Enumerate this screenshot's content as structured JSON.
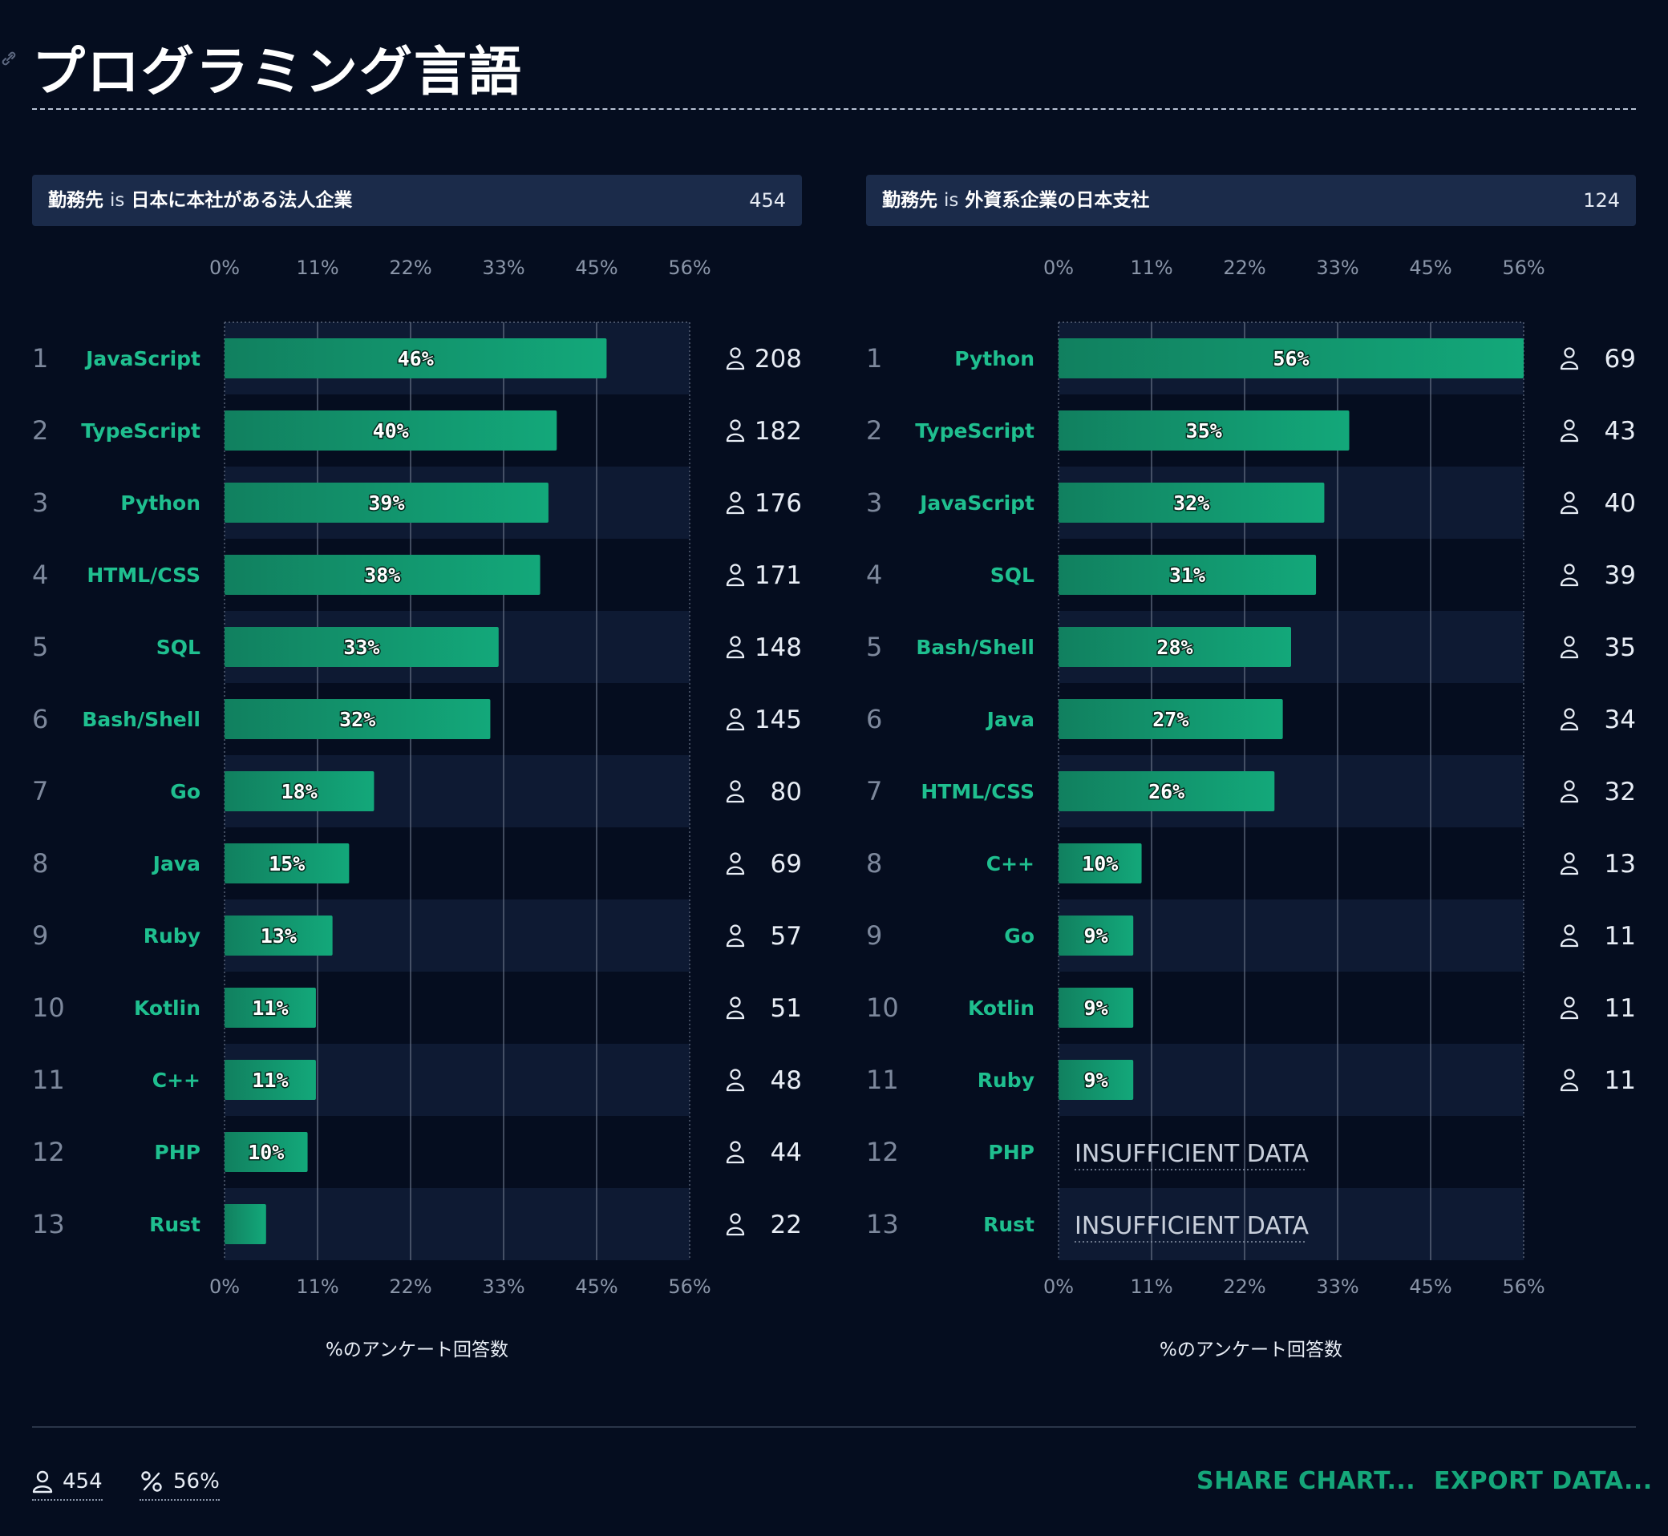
{
  "page": {
    "title": "プログラミング言語",
    "icons": [
      "link-icon",
      "person-icon",
      "percent-icon"
    ],
    "colors": {
      "background": "#050d1f",
      "bar": "#13a87a",
      "label": "#1fbf8f",
      "filter_bar": "#1b2b4a",
      "row_band": "#0e1a33"
    }
  },
  "panels": [
    {
      "filter_field": "勤務先",
      "filter_op": "is",
      "filter_value": "日本に本社がある法人企業",
      "total": "454",
      "axis_title": "%のアンケート回答数"
    },
    {
      "filter_field": "勤務先",
      "filter_op": "is",
      "filter_value": "外資系企業の日本支社",
      "total": "124",
      "axis_title": "%のアンケート回答数"
    }
  ],
  "chart_data": [
    {
      "type": "bar",
      "orientation": "horizontal",
      "xlim": [
        0,
        56
      ],
      "tick_labels": [
        "0%",
        "11%",
        "22%",
        "33%",
        "45%",
        "56%"
      ],
      "xlabel": "%のアンケート回答数",
      "grid": true,
      "categories": [
        "JavaScript",
        "TypeScript",
        "Python",
        "HTML/CSS",
        "SQL",
        "Bash/Shell",
        "Go",
        "Java",
        "Ruby",
        "Kotlin",
        "C++",
        "PHP",
        "Rust"
      ],
      "values": [
        46,
        40,
        39,
        38,
        33,
        32,
        18,
        15,
        13,
        11,
        11,
        10,
        5
      ],
      "value_labels": [
        "46%",
        "40%",
        "39%",
        "38%",
        "33%",
        "32%",
        "18%",
        "15%",
        "13%",
        "11%",
        "11%",
        "10%",
        ""
      ],
      "counts": [
        "208",
        "182",
        "176",
        "171",
        "148",
        "145",
        "80",
        "69",
        "57",
        "51",
        "48",
        "44",
        "22"
      ],
      "insufficient_label": ""
    },
    {
      "type": "bar",
      "orientation": "horizontal",
      "xlim": [
        0,
        56
      ],
      "tick_labels": [
        "0%",
        "11%",
        "22%",
        "33%",
        "45%",
        "56%"
      ],
      "xlabel": "%のアンケート回答数",
      "grid": true,
      "categories": [
        "Python",
        "TypeScript",
        "JavaScript",
        "SQL",
        "Bash/Shell",
        "Java",
        "HTML/CSS",
        "C++",
        "Go",
        "Kotlin",
        "Ruby",
        "PHP",
        "Rust"
      ],
      "values": [
        56,
        35,
        32,
        31,
        28,
        27,
        26,
        10,
        9,
        9,
        9,
        null,
        null
      ],
      "value_labels": [
        "56%",
        "35%",
        "32%",
        "31%",
        "28%",
        "27%",
        "26%",
        "10%",
        "9%",
        "9%",
        "9%",
        "",
        ""
      ],
      "counts": [
        "69",
        "43",
        "40",
        "39",
        "35",
        "34",
        "32",
        "13",
        "11",
        "11",
        "11",
        "",
        ""
      ],
      "insufficient_label": "INSUFFICIENT DATA"
    }
  ],
  "footer": {
    "respondents": "454",
    "max_percent": "56%",
    "share_label": "SHARE CHART...",
    "export_label": "EXPORT DATA..."
  }
}
